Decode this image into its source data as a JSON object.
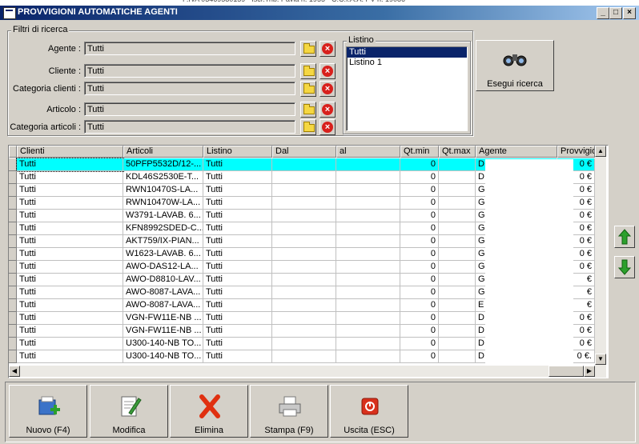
{
  "window": {
    "title": "PROVVIGIONI AUTOMATICHE AGENTI"
  },
  "filters": {
    "group_label": "Filtri di ricerca",
    "agente_label": "Agente :",
    "agente_value": "Tutti",
    "cliente_label": "Cliente :",
    "cliente_value": "Tutti",
    "catclienti_label": "Categoria clienti :",
    "catclienti_value": "Tutti",
    "articolo_label": "Articolo :",
    "articolo_value": "Tutti",
    "catarticoli_label": "Categoria articoli :",
    "catarticoli_value": "Tutti"
  },
  "listino": {
    "label": "Listino",
    "items": [
      "Tutti",
      "Listino 1"
    ]
  },
  "search_button": "Esegui ricerca",
  "grid": {
    "columns": [
      "Clienti",
      "Articoli",
      "Listino",
      "Dal",
      "al",
      "Qt.min",
      "Qt.max",
      "Agente",
      "Provvigioi"
    ],
    "rows": [
      [
        "Tutti",
        "50PFP5532D/12-...",
        "Tutti",
        "",
        "",
        "0",
        "",
        "D.",
        "0 €"
      ],
      [
        "Tutti",
        "KDL46S2530E-T...",
        "Tutti",
        "",
        "",
        "0",
        "",
        "D.",
        "0 €"
      ],
      [
        "Tutti",
        "RWN10470S-LA...",
        "Tutti",
        "",
        "",
        "0",
        "",
        "G",
        "0 €"
      ],
      [
        "Tutti",
        "RWN10470W-LA...",
        "Tutti",
        "",
        "",
        "0",
        "",
        "G",
        "0 €"
      ],
      [
        "Tutti",
        "W3791-LAVAB. 6...",
        "Tutti",
        "",
        "",
        "0",
        "",
        "G",
        "0 €"
      ],
      [
        "Tutti",
        "KFN8992SDED-C...",
        "Tutti",
        "",
        "",
        "0",
        "",
        "G",
        "0 €"
      ],
      [
        "Tutti",
        "AKT759/IX-PIAN...",
        "Tutti",
        "",
        "",
        "0",
        "",
        "G",
        "0 €"
      ],
      [
        "Tutti",
        "W1623-LAVAB. 6...",
        "Tutti",
        "",
        "",
        "0",
        "",
        "G",
        "0 €"
      ],
      [
        "Tutti",
        "AWO-DAS12-LA...",
        "Tutti",
        "",
        "",
        "0",
        "",
        "G",
        "0 €"
      ],
      [
        "Tutti",
        "AWO-D8810-LAV...",
        "Tutti",
        "",
        "",
        "0",
        "",
        "G",
        "€"
      ],
      [
        "Tutti",
        "AWO-8087-LAVA...",
        "Tutti",
        "",
        "",
        "0",
        "",
        "G",
        "€"
      ],
      [
        "Tutti",
        "AWO-8087-LAVA...",
        "Tutti",
        "",
        "",
        "0",
        "",
        "E",
        "€"
      ],
      [
        "Tutti",
        "VGN-FW11E-NB ...",
        "Tutti",
        "",
        "",
        "0",
        "",
        "D",
        "0 €"
      ],
      [
        "Tutti",
        "VGN-FW11E-NB ...",
        "Tutti",
        "",
        "",
        "0",
        "",
        "D",
        "0 €"
      ],
      [
        "Tutti",
        "U300-140-NB TO...",
        "Tutti",
        "",
        "",
        "0",
        "",
        "D.",
        "0 €"
      ],
      [
        "Tutti",
        "U300-140-NB TO...",
        "Tutti",
        "",
        "",
        "0",
        "",
        "D.",
        "0 €."
      ]
    ]
  },
  "buttons": {
    "nuovo": "Nuovo (F4)",
    "modifica": "Modifica",
    "elimina": "Elimina",
    "stampa": "Stampa (F9)",
    "uscita": "Uscita (ESC)"
  },
  "colors": {
    "selected_row": "#00ffff",
    "title_bar": "#0a246a",
    "face": "#d4d0c8"
  }
}
